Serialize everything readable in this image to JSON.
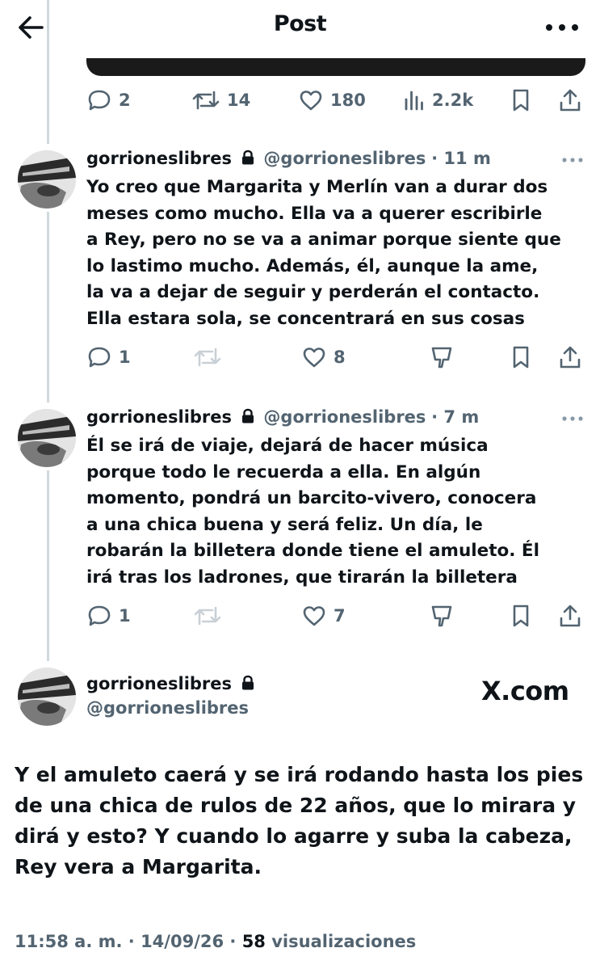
{
  "header": {
    "title": "Post"
  },
  "top_post": {
    "actions": {
      "replies": "2",
      "reposts": "14",
      "likes": "180",
      "views": "2.2k"
    }
  },
  "replies": [
    {
      "name": "gorrioneslibres",
      "handle": "@gorrioneslibres",
      "time": "· 11 m",
      "text_lines": [
        "Yo creo que Margarita y Merlín van a durar dos",
        "meses como mucho. Ella va a querer escribirle",
        "a Rey, pero no se va a animar porque siente que",
        "lo lastimo mucho. Además, él, aunque la ame,",
        "la va a dejar de seguir y perderán el contacto.",
        "Ella estara sola, se concentrará en sus cosas"
      ],
      "actions": {
        "replies": "1",
        "reposts": "",
        "likes": "8"
      }
    },
    {
      "name": "gorrioneslibres",
      "handle": "@gorrioneslibres",
      "time": "· 7 m",
      "text_lines": [
        "Él se irá de viaje, dejará de hacer música",
        "porque todo le recuerda a ella. En algún",
        "momento, pondrá un barcito-vivero, conocera",
        "a una chica buena y será feliz. Un día, le",
        "robarán la billetera donde tiene el amuleto. Él",
        "irá tras los ladrones, que tirarán la billetera"
      ],
      "actions": {
        "replies": "1",
        "reposts": "",
        "likes": "7"
      }
    }
  ],
  "main_post": {
    "name": "gorrioneslibres",
    "handle": "@gorrioneslibres",
    "brand": "X.com",
    "text_lines": [
      "Y el amuleto caerá y se irá rodando hasta los pies",
      "de una chica de rulos de 22 años, que lo mirara y",
      "dirá y esto? Y cuando lo agarre y suba la cabeza,",
      "Rey vera a Margarita."
    ],
    "timestamp": "11:58 a. m. · 14/09/26 · ",
    "views_count": "58",
    "views_label": " visualizaciones"
  },
  "icons": {
    "back": "arrow-left-icon",
    "more": "more-horizontal-icon",
    "reply": "reply-bubble-icon",
    "repost": "repost-icon",
    "like": "heart-icon",
    "views": "views-bars-icon",
    "bookmark": "bookmark-icon",
    "share": "share-icon",
    "downvote": "downvote-icon",
    "lock": "lock-icon"
  },
  "colors": {
    "text": "#0f1419",
    "secondary": "#536471",
    "thread_line": "#cfd9de"
  }
}
